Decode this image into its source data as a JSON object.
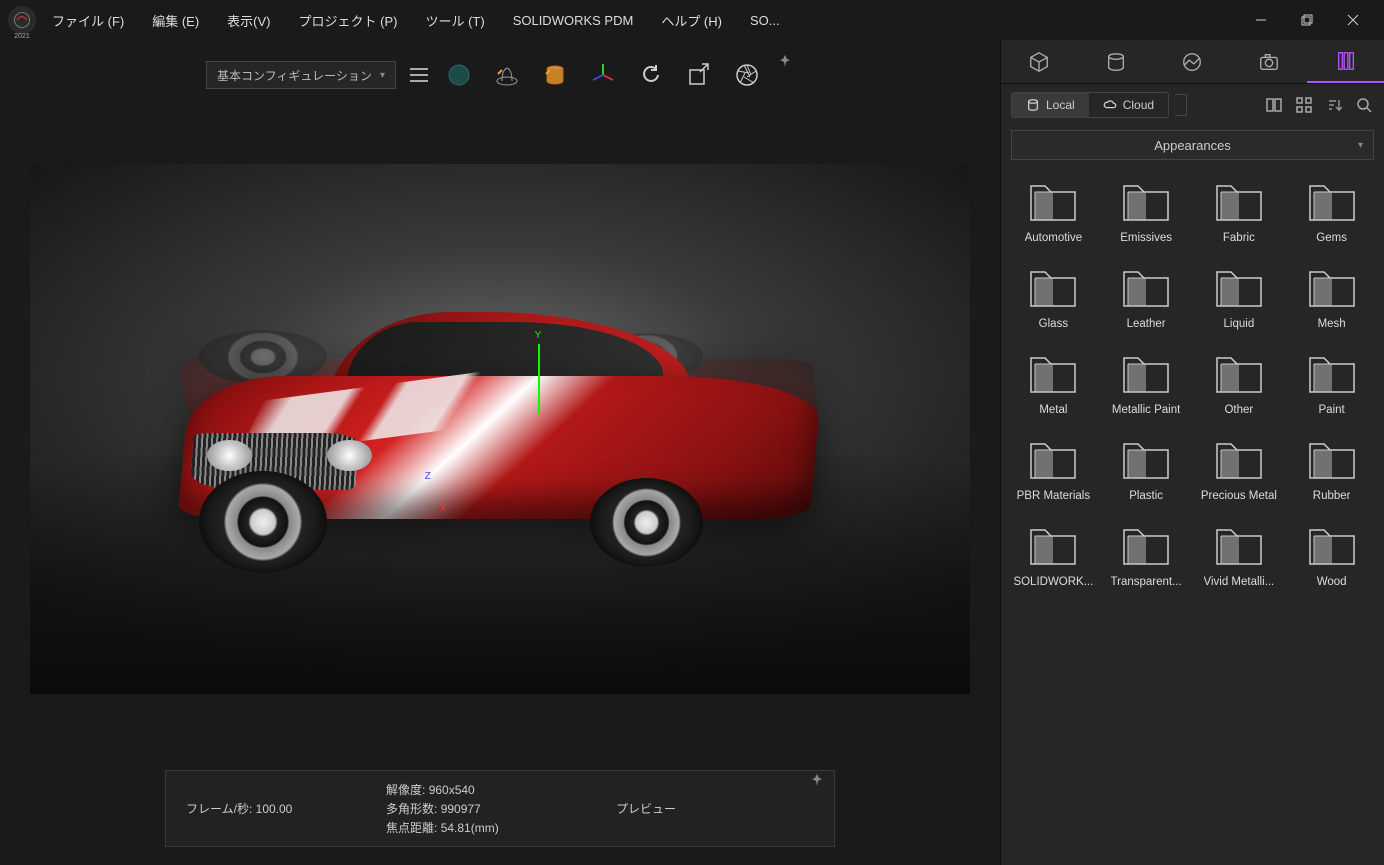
{
  "app_logo_year": "2021",
  "menu": {
    "file": "ファイル (F)",
    "edit": "編集 (E)",
    "view": "表示(V)",
    "project": "プロジェクト (P)",
    "tools": "ツール (T)",
    "pdm": "SOLIDWORKS PDM",
    "help": "ヘルプ (H)",
    "so": "SO..."
  },
  "toolbar": {
    "config": "基本コンフィギュレーション"
  },
  "status": {
    "fps_label": "フレーム/秒:",
    "fps_val": "100.00",
    "res_label": "解像度:",
    "res_val": "960x540",
    "poly_label": "多角形数:",
    "poly_val": "990977",
    "focal_label": "焦点距離:",
    "focal_val": "54.81(mm)",
    "preview": "プレビュー"
  },
  "side": {
    "local": "Local",
    "cloud": "Cloud",
    "appearances": "Appearances",
    "folders": [
      "Automotive",
      "Emissives",
      "Fabric",
      "Gems",
      "Glass",
      "Leather",
      "Liquid",
      "Mesh",
      "Metal",
      "Metallic Paint",
      "Other",
      "Paint",
      "PBR Materials",
      "Plastic",
      "Precious Metal",
      "Rubber",
      "SOLIDWORK...",
      "Transparent...",
      "Vivid Metalli...",
      "Wood"
    ]
  }
}
